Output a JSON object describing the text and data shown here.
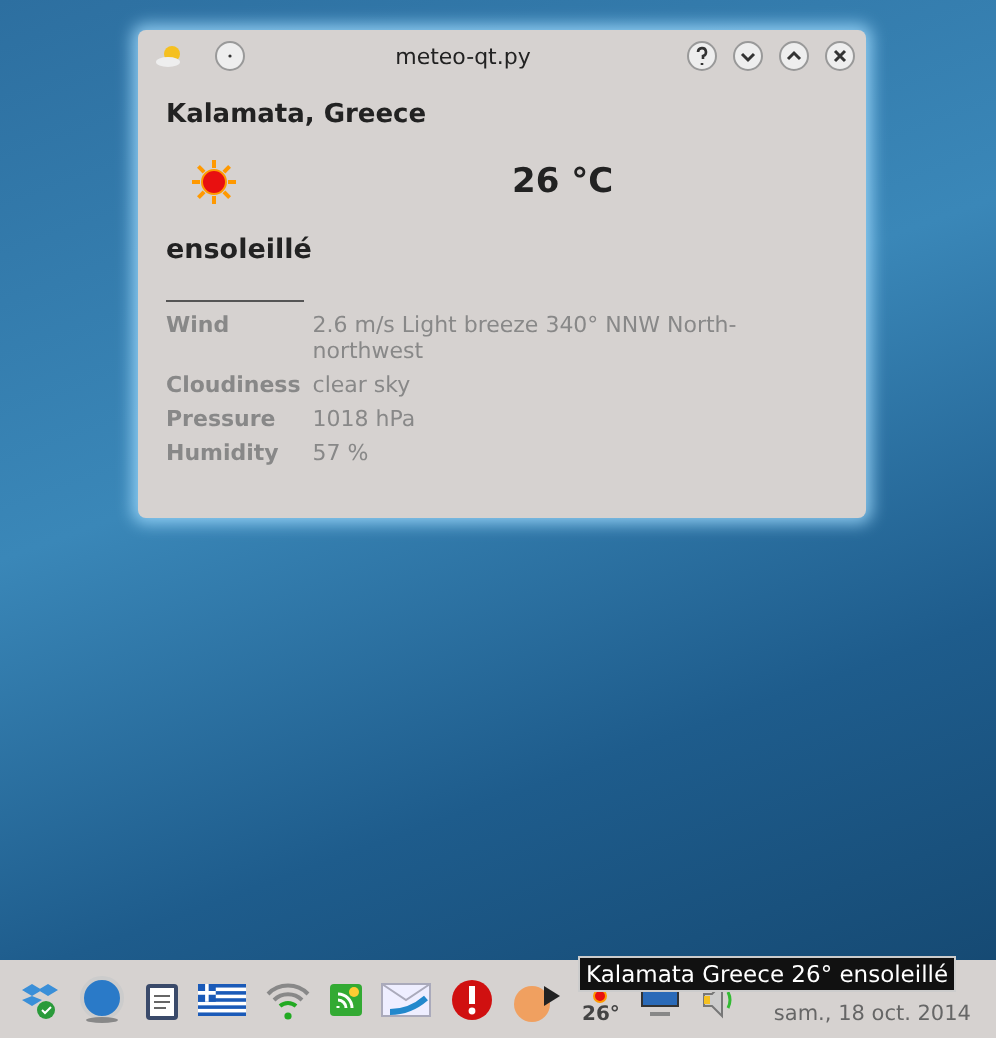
{
  "window": {
    "title": "meteo-qt.py"
  },
  "city": "Kalamata, Greece",
  "temperature": "26 °C",
  "condition": "ensoleillé",
  "details": [
    {
      "label": "Wind",
      "value": "2.6 m/s Light breeze 340° NNW North-northwest"
    },
    {
      "label": "Cloudiness",
      "value": "clear sky"
    },
    {
      "label": "Pressure",
      "value": "1018 hPa"
    },
    {
      "label": "Humidity",
      "value": "57 %"
    }
  ],
  "taskbar": {
    "tray_temperature": "26°",
    "clock": "sam., 18 oct. 2014",
    "tooltip": "Kalamata Greece  26° ensoleillé"
  }
}
